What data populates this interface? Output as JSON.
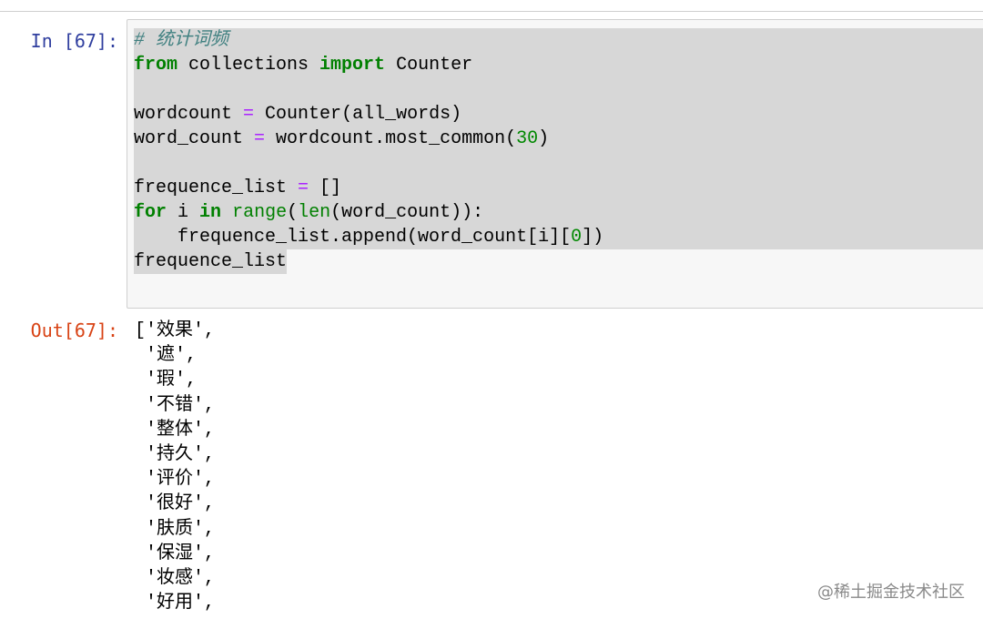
{
  "cell": {
    "in_prompt": "In  [67]:",
    "out_prompt": "Out[67]:",
    "code": {
      "l1_comment": "# 统计词频",
      "l2_from": "from",
      "l2_mod": " collections ",
      "l2_import": "import",
      "l2_name": " Counter",
      "l4_var": "wordcount ",
      "l4_eq": "=",
      "l4_rest": " Counter(all_words)",
      "l5_var": "word_count ",
      "l5_eq": "=",
      "l5_rest": " wordcount.most_common(",
      "l5_num": "30",
      "l5_close": ")",
      "l7_var": "frequence_list ",
      "l7_eq": "=",
      "l7_rest": " []",
      "l8_for": "for",
      "l8_i": " i ",
      "l8_in": "in",
      "l8_sp": " ",
      "l8_range": "range",
      "l8_p1": "(",
      "l8_len": "len",
      "l8_rest": "(word_count)):",
      "l9_rest": "    frequence_list.append(word_count[i][",
      "l9_num": "0",
      "l9_close": "])",
      "l10": "frequence_list"
    },
    "output_lines": [
      "['效果',",
      " '遮',",
      " '瑕',",
      " '不错',",
      " '整体',",
      " '持久',",
      " '评价',",
      " '很好',",
      " '肤质',",
      " '保湿',",
      " '妆感',",
      " '好用',"
    ]
  },
  "watermark": "@稀土掘金技术社区"
}
